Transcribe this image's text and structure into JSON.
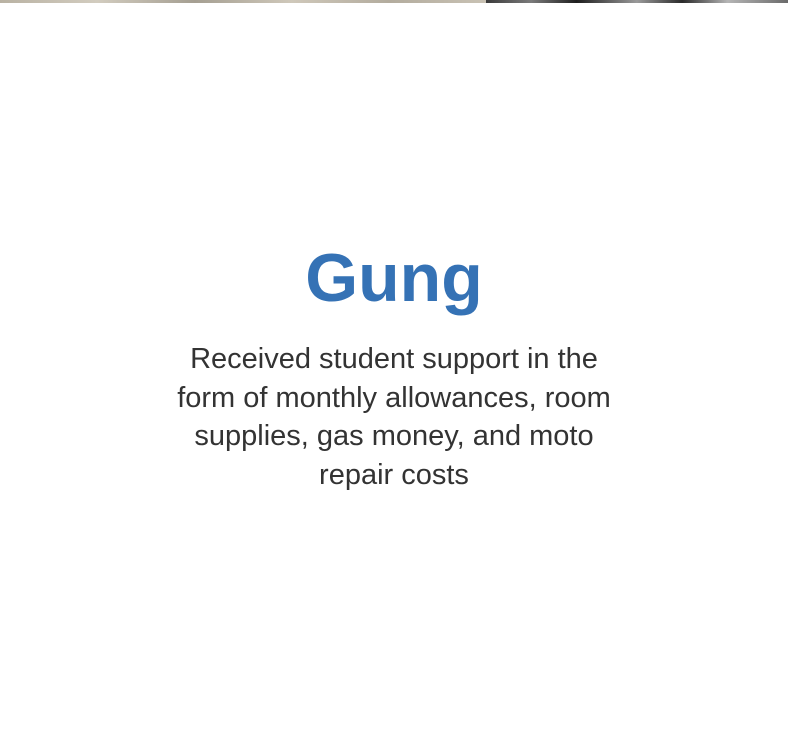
{
  "theme": {
    "accent": "#3572b5",
    "text": "#333333",
    "background": "#ffffff"
  },
  "profile": {
    "name": "Gung",
    "description": "Received student support in the form of monthly allowances, room supplies, gas money, and moto repair costs"
  }
}
